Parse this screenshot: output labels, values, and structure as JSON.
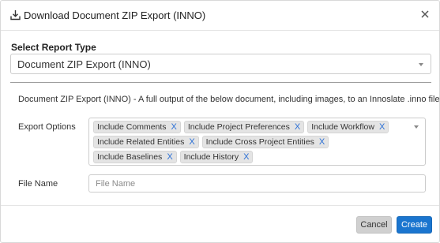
{
  "dialog": {
    "title": "Download Document ZIP Export (INNO)",
    "icons": {
      "title_icon": "download-icon",
      "close": "close-icon"
    }
  },
  "report_type": {
    "label": "Select Report Type",
    "selected": "Document ZIP Export (INNO)"
  },
  "description": "Document ZIP Export (INNO)  -  A full output of the below document, including images, to an Innoslate .inno file.",
  "export_options": {
    "label": "Export Options",
    "remove_glyph": "X",
    "selected": [
      "Include Comments",
      "Include Project Preferences",
      "Include Workflow",
      "Include Related Entities",
      "Include Cross Project Entities",
      "Include Baselines",
      "Include History"
    ]
  },
  "file_name": {
    "label": "File Name",
    "value": "",
    "placeholder": "File Name"
  },
  "buttons": {
    "cancel": "Cancel",
    "create": "Create"
  },
  "colors": {
    "primary": "#1a75cf",
    "chip_remove": "#2a6fd6",
    "cancel_bg": "#d0d0d0"
  }
}
